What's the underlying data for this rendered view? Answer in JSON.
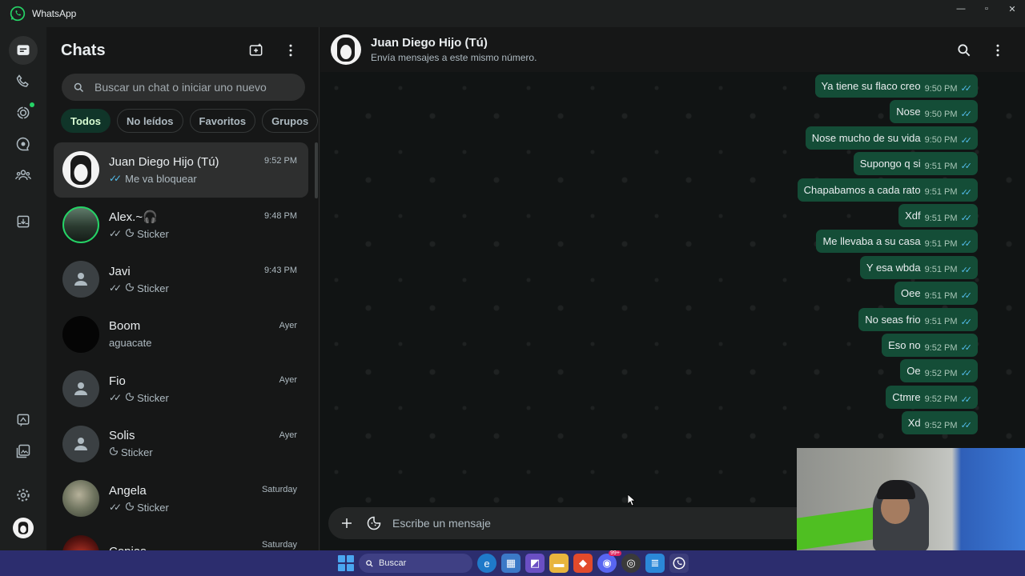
{
  "window": {
    "title": "WhatsApp"
  },
  "rail": {
    "items": [
      {
        "name": "chats-icon",
        "active": true
      },
      {
        "name": "calls-icon"
      },
      {
        "name": "status-icon",
        "dot": true
      },
      {
        "name": "channels-icon"
      },
      {
        "name": "communities-icon"
      },
      {
        "name": "archived-icon"
      },
      {
        "name": "starred-icon"
      },
      {
        "name": "media-icon"
      },
      {
        "name": "settings-icon"
      },
      {
        "name": "profile-avatar"
      }
    ]
  },
  "chatlist": {
    "title": "Chats",
    "search_placeholder": "Buscar un chat o iniciar uno nuevo",
    "filters": [
      "Todos",
      "No leídos",
      "Favoritos",
      "Grupos"
    ],
    "items": [
      {
        "name": "Juan Diego Hijo (Tú)",
        "time": "9:52 PM",
        "message": "Me va bloquear",
        "ticks": "blue",
        "sticker": false,
        "avatar": "self",
        "selected": true
      },
      {
        "name": "Alex.~🎧",
        "time": "9:48 PM",
        "message": "Sticker",
        "ticks": "gray",
        "sticker": true,
        "avatar": "alex"
      },
      {
        "name": "Javi",
        "time": "9:43 PM",
        "message": "Sticker",
        "ticks": "gray",
        "sticker": true,
        "avatar": "default"
      },
      {
        "name": "Boom",
        "time": "Ayer",
        "message": "aguacate",
        "ticks": "none",
        "sticker": false,
        "avatar": "black"
      },
      {
        "name": "Fio",
        "time": "Ayer",
        "message": "Sticker",
        "ticks": "gray",
        "sticker": true,
        "avatar": "default"
      },
      {
        "name": "Solis",
        "time": "Ayer",
        "message": "Sticker",
        "ticks": "none",
        "sticker": true,
        "avatar": "default"
      },
      {
        "name": "Angela",
        "time": "Saturday",
        "message": "Sticker",
        "ticks": "gray",
        "sticker": true,
        "avatar": "angela"
      },
      {
        "name": "Copias",
        "time": "Saturday",
        "message": "",
        "ticks": "none",
        "sticker": false,
        "avatar": "copias"
      }
    ]
  },
  "conversation": {
    "name": "Juan Diego Hijo (Tú)",
    "subtitle": "Envía mensajes a este mismo número.",
    "composer_placeholder": "Escribe un mensaje",
    "messages": [
      {
        "text": "Ya tiene su flaco creo",
        "time": "9:50 PM"
      },
      {
        "text": "Nose",
        "time": "9:50 PM"
      },
      {
        "text": "Nose mucho de su vida",
        "time": "9:50 PM"
      },
      {
        "text": "Supongo q si",
        "time": "9:51 PM"
      },
      {
        "text": "Chapabamos a cada rato",
        "time": "9:51 PM"
      },
      {
        "text": "Xdf",
        "time": "9:51 PM"
      },
      {
        "text": "Me llevaba a su casa",
        "time": "9:51 PM"
      },
      {
        "text": "Y esa wbda",
        "time": "9:51 PM"
      },
      {
        "text": "Oee",
        "time": "9:51 PM"
      },
      {
        "text": "No seas frio",
        "time": "9:51 PM"
      },
      {
        "text": "Eso no",
        "time": "9:52 PM"
      },
      {
        "text": "Oe",
        "time": "9:52 PM"
      },
      {
        "text": "Ctmre",
        "time": "9:52 PM"
      },
      {
        "text": "Xd",
        "time": "9:52 PM"
      }
    ]
  },
  "taskbar": {
    "search_label": "Buscar",
    "apps": [
      "edge-icon",
      "store-icon",
      "office-icon",
      "file-explorer-icon",
      "brave-icon",
      "discord-icon",
      "chrome-icon",
      "notepad-icon",
      "whatsapp-icon"
    ],
    "discord_badge": "99+"
  },
  "colors": {
    "accent": "#25d366",
    "bubble_out": "#144d37",
    "read_tick": "#53bdeb",
    "taskbar": "#2c2d6e"
  }
}
